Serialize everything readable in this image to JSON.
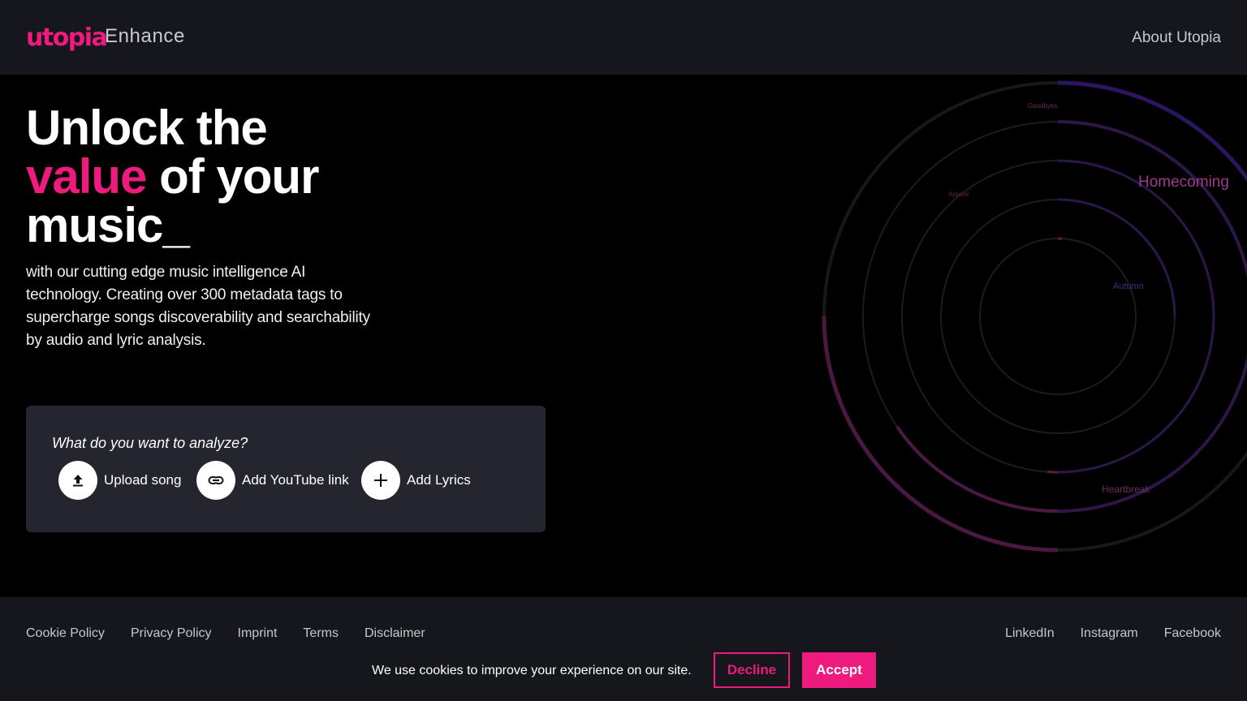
{
  "header": {
    "logo_text": "utopia",
    "product_name": "Enhance",
    "about_link": "About Utopia"
  },
  "hero": {
    "title_line1": "Unlock the",
    "title_accent": "value",
    "title_line2_rest": " of your",
    "title_line3": "music_",
    "description": "with our cutting edge music intelligence AI technology. Creating over 300 metadata tags to supercharge songs discoverability and searchability by audio and lyric analysis."
  },
  "analyze": {
    "question": "What do you want to analyze?",
    "actions": [
      {
        "label": "Upload song",
        "icon": "upload-icon"
      },
      {
        "label": "Add YouTube link",
        "icon": "link-icon"
      },
      {
        "label": "Add Lyrics",
        "icon": "plus-icon"
      }
    ]
  },
  "visual": {
    "tags": [
      "Goodbyes",
      "Homecoming",
      "Appeal",
      "Autumn",
      "Heartbreak"
    ]
  },
  "footer": {
    "links": [
      "Cookie Policy",
      "Privacy Policy",
      "Imprint",
      "Terms",
      "Disclaimer"
    ],
    "social": [
      "LinkedIn",
      "Instagram",
      "Facebook"
    ]
  },
  "cookie": {
    "message": "We use cookies to improve your experience on our site.",
    "decline": "Decline",
    "accept": "Accept"
  },
  "colors": {
    "accent": "#ee1a7d",
    "header_bg": "#16171c",
    "card_bg": "#24252e"
  }
}
